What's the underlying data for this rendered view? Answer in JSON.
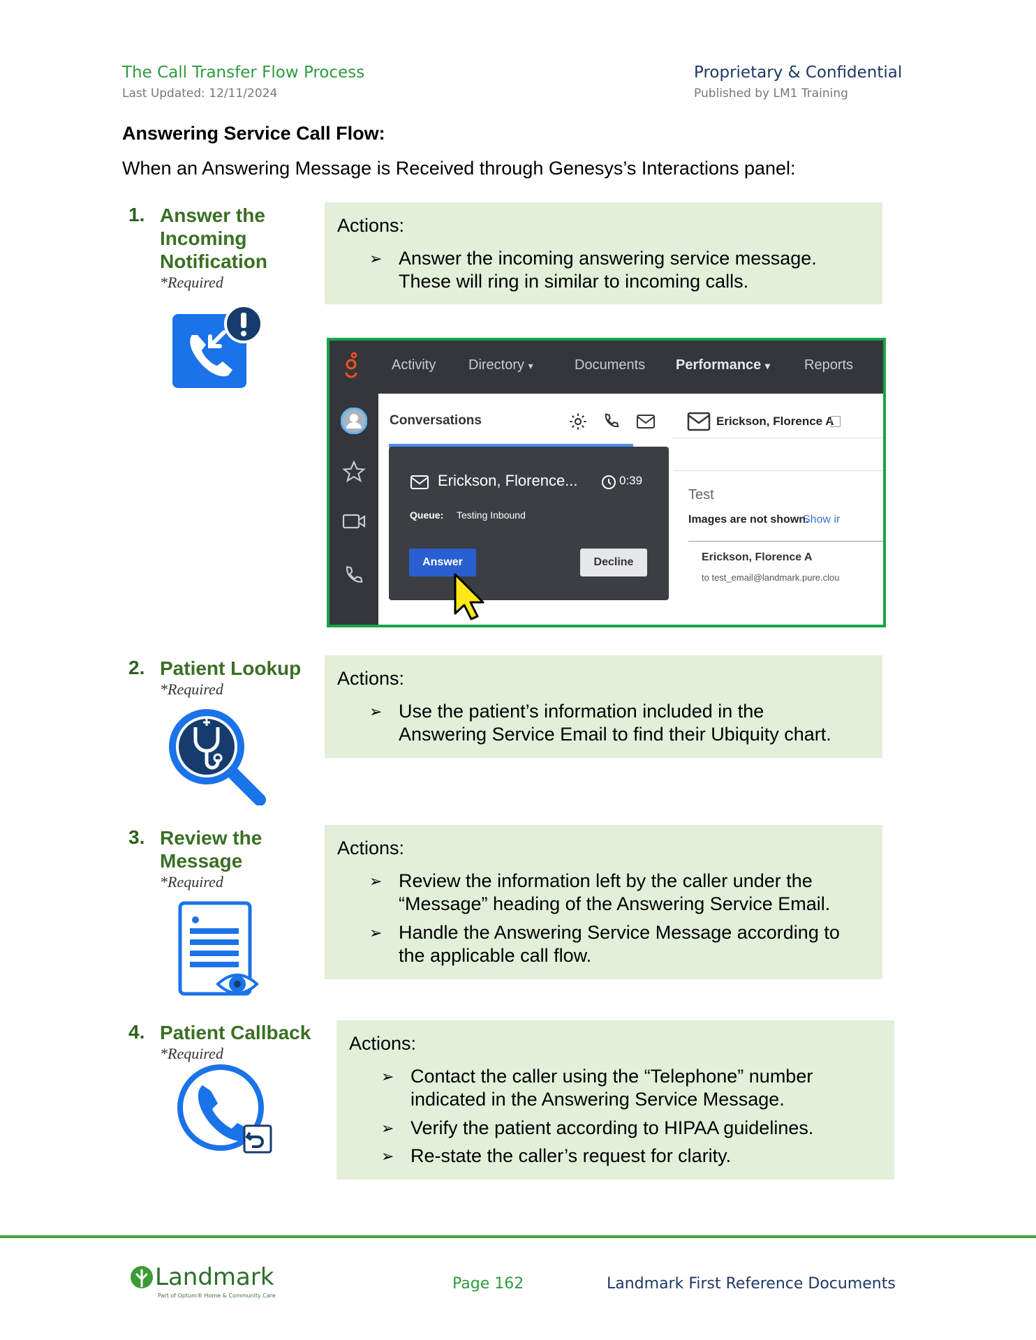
{
  "header": {
    "doc_title": "The Call Transfer Flow Process",
    "last_updated": "Last Updated: 12/11/2024",
    "confidential": "Proprietary & Confidential",
    "published_by": "Published by LM1 Training"
  },
  "section_title": "Answering Service Call Flow:",
  "intro": "When an Answering Message is Received through Genesys’s Interactions panel:",
  "steps": [
    {
      "number": "1.",
      "title_lines": [
        "Answer the",
        "Incoming",
        "Notification"
      ],
      "required": "*Required",
      "actions_label": "Actions:",
      "bullets": [
        [
          "Answer the incoming answering service message.",
          "These will ring in similar to incoming calls."
        ]
      ]
    },
    {
      "number": "2.",
      "title_lines": [
        "Patient Lookup"
      ],
      "required": "*Required",
      "actions_label": "Actions:",
      "bullets": [
        [
          "Use the patient’s information included in the",
          "Answering Service Email to find their Ubiquity chart."
        ]
      ]
    },
    {
      "number": "3.",
      "title_lines": [
        "Review the",
        "Message"
      ],
      "required": "*Required",
      "actions_label": "Actions:",
      "bullets": [
        [
          "Review the information left by the caller under the",
          "“Message” heading of the Answering Service Email."
        ],
        [
          "Handle the Answering Service Message according to",
          "the applicable call flow."
        ]
      ]
    },
    {
      "number": "4.",
      "title_lines": [
        "Patient Callback"
      ],
      "required": "*Required",
      "actions_label": "Actions:",
      "bullets": [
        [
          "Contact the caller using the “Telephone” number",
          "indicated in the Answering Service Message."
        ],
        [
          "Verify the patient according to HIPAA guidelines."
        ],
        [
          "Re-state the caller’s request for clarity."
        ]
      ]
    }
  ],
  "app": {
    "nav": [
      "Activity",
      "Directory",
      "Documents",
      "Performance",
      "Reports"
    ],
    "conversations_label": "Conversations",
    "card_name": "Erickson, Florence...",
    "card_timer": "0:39",
    "queue_label": "Queue:",
    "queue_value": "Testing Inbound",
    "answer_label": "Answer",
    "decline_label": "Decline",
    "email_header_name": "Erickson, Florence A",
    "email_subject": "Test",
    "images_notice": "Images are not shown.",
    "show_link": "Show ir",
    "sender_name": "Erickson, Florence A",
    "to_line": "to test_email@landmark.pure.clou"
  },
  "footer": {
    "logo": "Landmark",
    "logo_sub": "Part of Optum® Home & Community Care",
    "page": "Page 162",
    "doc": "Landmark First Reference Documents"
  },
  "colors": {
    "accent_green": "#2e9a3e",
    "box_green": "#e2efd9",
    "icon_blue": "#1a73e8",
    "nav_dark": "#33363b"
  }
}
